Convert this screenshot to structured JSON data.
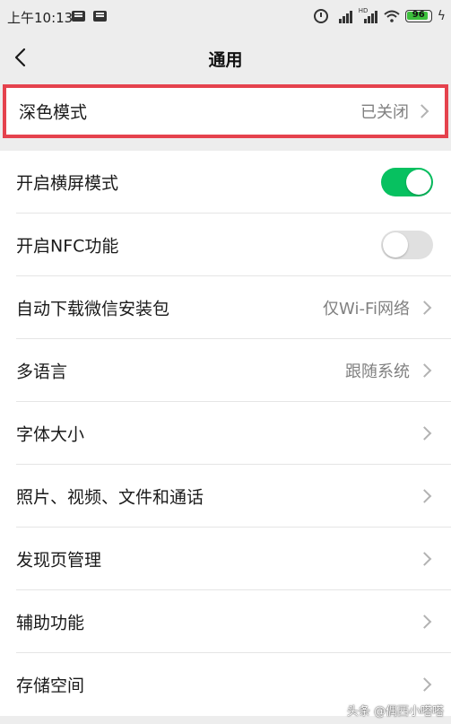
{
  "status_bar": {
    "time": "上午10:13",
    "signal_tag_1": "",
    "signal_tag_2": "HD",
    "battery_level": "96",
    "battery_color": "#3cbf3c"
  },
  "nav": {
    "title": "通用",
    "back_icon": "chevron-left-icon"
  },
  "dark_mode": {
    "label": "深色模式",
    "value": "已关闭",
    "highlight_color": "#e5424d"
  },
  "settings": [
    {
      "label": "开启横屏模式",
      "type": "toggle",
      "on": true
    },
    {
      "label": "开启NFC功能",
      "type": "toggle",
      "on": false
    },
    {
      "label": "自动下载微信安装包",
      "type": "link",
      "value": "仅Wi-Fi网络"
    },
    {
      "label": "多语言",
      "type": "link",
      "value": "跟随系统"
    },
    {
      "label": "字体大小",
      "type": "link",
      "value": ""
    },
    {
      "label": "照片、视频、文件和通话",
      "type": "link",
      "value": ""
    },
    {
      "label": "发现页管理",
      "type": "link",
      "value": ""
    },
    {
      "label": "辅助功能",
      "type": "link",
      "value": ""
    },
    {
      "label": "存储空间",
      "type": "link",
      "value": ""
    }
  ],
  "colors": {
    "toggle_on": "#07c160",
    "toggle_off": "#e0e0e0",
    "background": "#ededed"
  },
  "watermark": "头条 @偶西小嗒嗒"
}
